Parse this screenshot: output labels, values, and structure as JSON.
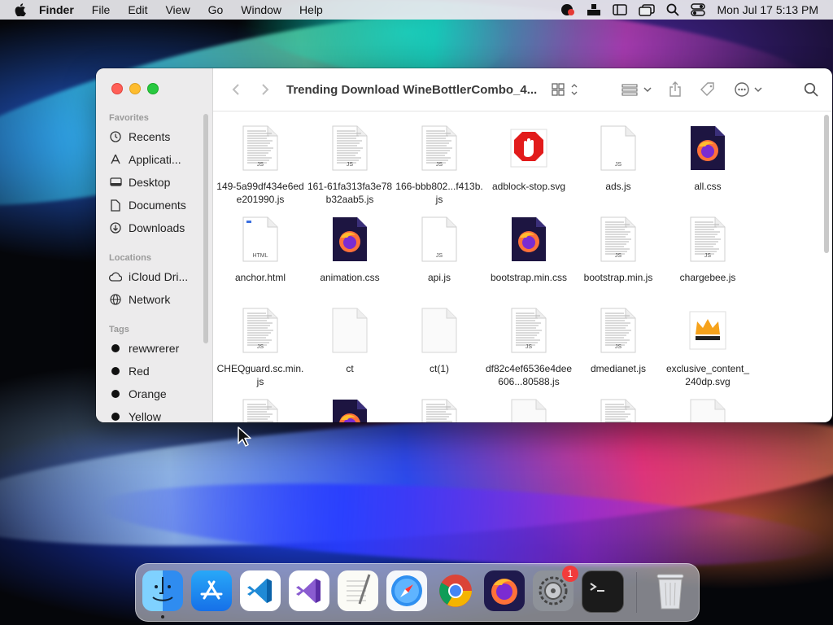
{
  "menubar": {
    "app_name": "Finder",
    "menus": [
      "File",
      "Edit",
      "View",
      "Go",
      "Window",
      "Help"
    ],
    "clock": "Mon Jul 17  5:13 PM"
  },
  "finder": {
    "title": "Trending Download WineBottlerCombo_4...",
    "sidebar": {
      "favorites_header": "Favorites",
      "favorites": [
        "Recents",
        "Applicati...",
        "Desktop",
        "Documents",
        "Downloads"
      ],
      "locations_header": "Locations",
      "locations": [
        "iCloud Dri...",
        "Network"
      ],
      "tags_header": "Tags",
      "tags": [
        "rewwrerer",
        "Red",
        "Orange",
        "Yellow"
      ],
      "tag_colors": [
        "#1a1a1a",
        "#1a1a1a",
        "#1a1a1a",
        "#1a1a1a"
      ]
    },
    "files": [
      {
        "name": "149-5a99df434e6ede201990.js",
        "icon": "js-doc-icon"
      },
      {
        "name": "161-61fa313fa3e78b32aab5.js",
        "icon": "js-doc-icon"
      },
      {
        "name": "166-bbb802...f413b.js",
        "icon": "js-doc-icon"
      },
      {
        "name": "adblock-stop.svg",
        "icon": "adblock-stop-icon"
      },
      {
        "name": "ads.js",
        "icon": "js-blank-icon"
      },
      {
        "name": "all.css",
        "icon": "firefox-doc-icon"
      },
      {
        "name": "anchor.html",
        "icon": "html-doc-icon"
      },
      {
        "name": "animation.css",
        "icon": "firefox-doc-icon"
      },
      {
        "name": "api.js",
        "icon": "js-blank-icon"
      },
      {
        "name": "bootstrap.min.css",
        "icon": "firefox-doc-icon"
      },
      {
        "name": "bootstrap.min.js",
        "icon": "js-doc-icon"
      },
      {
        "name": "chargebee.js",
        "icon": "js-doc-icon"
      },
      {
        "name": "CHEQguard.sc.min.js",
        "icon": "js-doc-icon"
      },
      {
        "name": "ct",
        "icon": "blank-doc-icon"
      },
      {
        "name": "ct(1)",
        "icon": "blank-doc-icon"
      },
      {
        "name": "df82c4ef6536e4dee606...80588.js",
        "icon": "js-doc-icon"
      },
      {
        "name": "dmedianet.js",
        "icon": "js-doc-icon"
      },
      {
        "name": "exclusive_content_240dp.svg",
        "icon": "crown-icon"
      }
    ],
    "doc_labels": {
      "js": "JS",
      "html": "HTML"
    }
  },
  "dock": {
    "apps": [
      "finder-icon",
      "app-store-icon",
      "vscode-icon",
      "visual-studio-icon",
      "textedit-icon",
      "safari-icon",
      "chrome-icon",
      "firefox-icon",
      "system-settings-icon",
      "terminal-icon",
      "trash-icon"
    ],
    "settings_badge": "1"
  }
}
